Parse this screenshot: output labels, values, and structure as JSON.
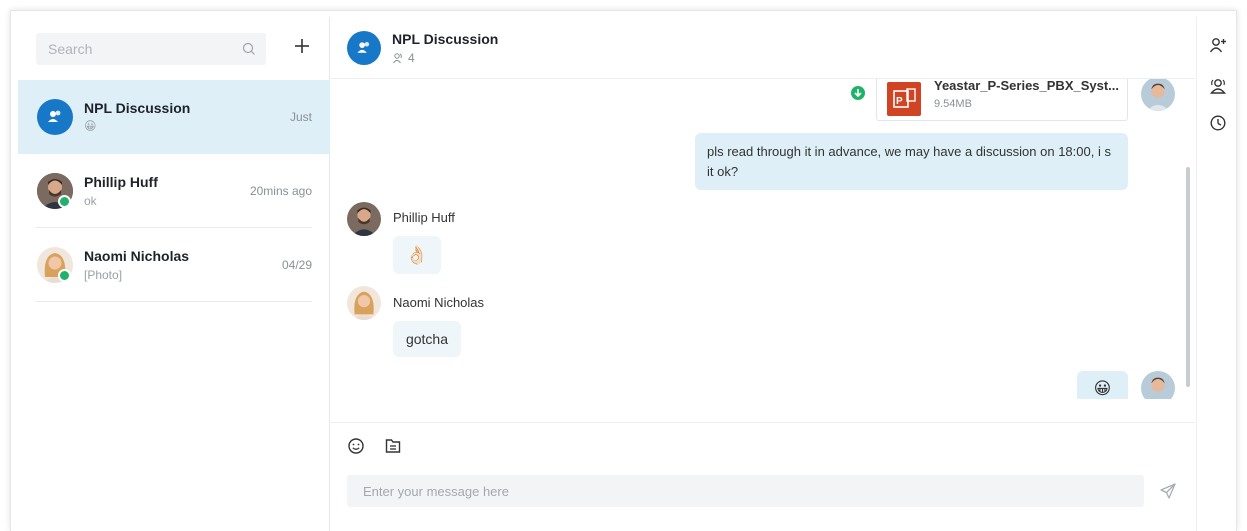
{
  "sidebar": {
    "search_placeholder": "Search",
    "conversations": [
      {
        "name": "NPL Discussion",
        "preview": "😀",
        "time": "Just",
        "active": true,
        "avatar": "group-icon"
      },
      {
        "name": "Phillip Huff",
        "preview": "ok",
        "time": "20mins ago",
        "active": false,
        "avatar": "phillip-avatar",
        "status": "online"
      },
      {
        "name": "Naomi Nicholas",
        "preview": "[Photo]",
        "time": "04/29",
        "active": false,
        "avatar": "naomi-avatar",
        "status": "online"
      }
    ]
  },
  "chat": {
    "title": "NPL Discussion",
    "member_count": "4",
    "messages": {
      "file": {
        "name": "Yeastar_P-Series_PBX_Syst...",
        "size": "9.54MB"
      },
      "outgoing_text": "pls read through it in advance, we may have a discussion on 18:00, i s it ok?",
      "phillip": {
        "sender": "Phillip Huff",
        "content": "👌🏻"
      },
      "naomi": {
        "sender": "Naomi Nicholas",
        "content": "gotcha"
      },
      "last_outgoing": "😀"
    },
    "composer": {
      "placeholder": "Enter your message here"
    }
  },
  "colors": {
    "accent": "#1878c8",
    "active_row": "#deeff7",
    "online": "#1fb36a",
    "ppt": "#d04323"
  }
}
